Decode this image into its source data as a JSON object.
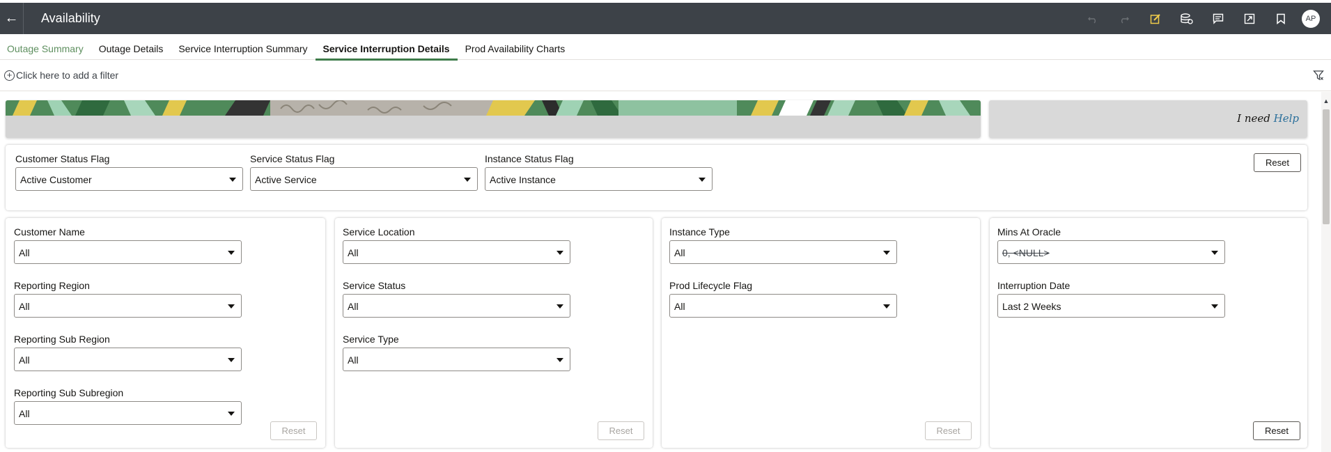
{
  "header": {
    "title": "Availability"
  },
  "tabs": [
    {
      "label": "Outage Summary"
    },
    {
      "label": "Outage Details"
    },
    {
      "label": "Service Interruption Summary"
    },
    {
      "label": "Service Interruption Details"
    },
    {
      "label": "Prod Availability Charts"
    }
  ],
  "filter_bar": {
    "add_filter": "Click here to add a filter"
  },
  "avatar": {
    "initials": "AP"
  },
  "help": {
    "prefix": "I need",
    "link": "Help"
  },
  "status_flags": {
    "customer": {
      "label": "Customer Status Flag",
      "value": "Active Customer"
    },
    "service": {
      "label": "Service Status Flag",
      "value": "Active Service"
    },
    "instance": {
      "label": "Instance Status Flag",
      "value": "Active Instance"
    },
    "reset": "Reset"
  },
  "panel1": {
    "customer_name": {
      "label": "Customer Name",
      "value": "All"
    },
    "reporting_region": {
      "label": "Reporting Region",
      "value": "All"
    },
    "reporting_sub_region": {
      "label": "Reporting Sub Region",
      "value": "All"
    },
    "reporting_sub_subregion": {
      "label": "Reporting Sub Subregion",
      "value": "All"
    },
    "reset": "Reset"
  },
  "panel2": {
    "service_location": {
      "label": "Service Location",
      "value": "All"
    },
    "service_status": {
      "label": "Service Status",
      "value": "All"
    },
    "service_type": {
      "label": "Service Type",
      "value": "All"
    },
    "reset": "Reset"
  },
  "panel3": {
    "instance_type": {
      "label": "Instance Type",
      "value": "All"
    },
    "prod_lifecycle_flag": {
      "label": "Prod Lifecycle Flag",
      "value": "All"
    },
    "reset": "Reset"
  },
  "panel4": {
    "mins_at_oracle": {
      "label": "Mins At Oracle",
      "value": "0, <NULL>"
    },
    "interruption_date": {
      "label": "Interruption Date",
      "value": "Last 2 Weeks"
    },
    "reset": "Reset"
  },
  "colors": {
    "header_bg": "#3d4248",
    "accent_green": "#3e7c4a",
    "visited_tab": "#5e8f5f",
    "help_link": "#2a6f9b",
    "icon_yellow": "#f0cc4a"
  }
}
